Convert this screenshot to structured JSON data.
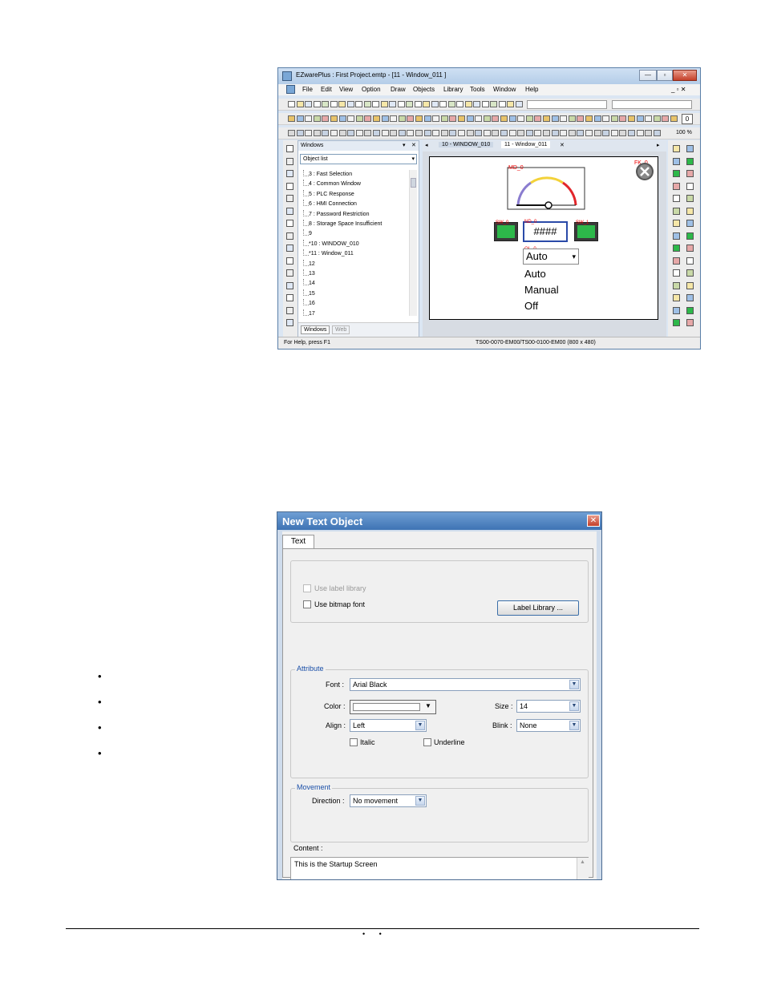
{
  "app": {
    "title": "EZwarePlus : First Project.emtp - [11 - Window_011 ]",
    "window_buttons": {
      "minimize": "—",
      "restore": "▫",
      "close": "✕"
    },
    "menu": [
      "File",
      "Edit",
      "View",
      "Option",
      "Draw",
      "Objects",
      "Library",
      "Tools",
      "Window",
      "Help"
    ],
    "menu_right": "_ ▫ ✕",
    "zoom": "100 %",
    "zero": "0",
    "windows_panel": {
      "title": "Windows",
      "dropdown": "Object list",
      "items": [
        "3 : Fast Selection",
        "4 : Common Window",
        "5 : PLC Response",
        "6 : HMI Connection",
        "7 : Password Restriction",
        "8 : Storage Space Insufficient",
        "9",
        "*10 : WINDOW_010",
        "*11 : Window_011",
        "12",
        "13",
        "14",
        "15",
        "16",
        "17"
      ],
      "tabs": [
        "Windows",
        "Web"
      ]
    },
    "doc_tabs": [
      "10 - WINDOW_010",
      "11 - Window_011"
    ],
    "tab_close": "✕",
    "canvas": {
      "meter_label": "MD_0",
      "fk_label": "FK_0",
      "display": "####",
      "display_label": "ND_0",
      "left_btn_label": "SW_0",
      "right_btn_label": "SW_1",
      "option_label": "OL_0",
      "option_selected": "Auto",
      "options": [
        "Auto",
        "Manual",
        "Off"
      ]
    },
    "status_left": "For Help, press F1",
    "status_right": "TS00-0070-EM00/TS00-0100-EM00 (800 x 480)"
  },
  "dialog": {
    "title": "New  Text Object",
    "close": "✕",
    "tab": "Text",
    "use_label_library": "Use label library",
    "use_bitmap_font": "Use bitmap font",
    "label_library_button": "Label Library ...",
    "attribute_legend": "Attribute",
    "font_label": "Font :",
    "font_value": "Arial Black",
    "color_label": "Color :",
    "size_label": "Size :",
    "size_value": "14",
    "align_label": "Align :",
    "align_value": "Left",
    "blink_label": "Blink :",
    "blink_value": "None",
    "italic": "Italic",
    "underline": "Underline",
    "movement_legend": "Movement",
    "direction_label": "Direction :",
    "direction_value": "No movement",
    "content_label": "Content :",
    "content_value": "This is the Startup Screen"
  },
  "bullets": [
    "•",
    "•",
    "•",
    "•"
  ],
  "footer": {
    "dots": "•       •"
  },
  "colors": {
    "dialog_title": "#3e73b4",
    "legend": "#1a4fa8",
    "green_btn": "#2db84a"
  }
}
